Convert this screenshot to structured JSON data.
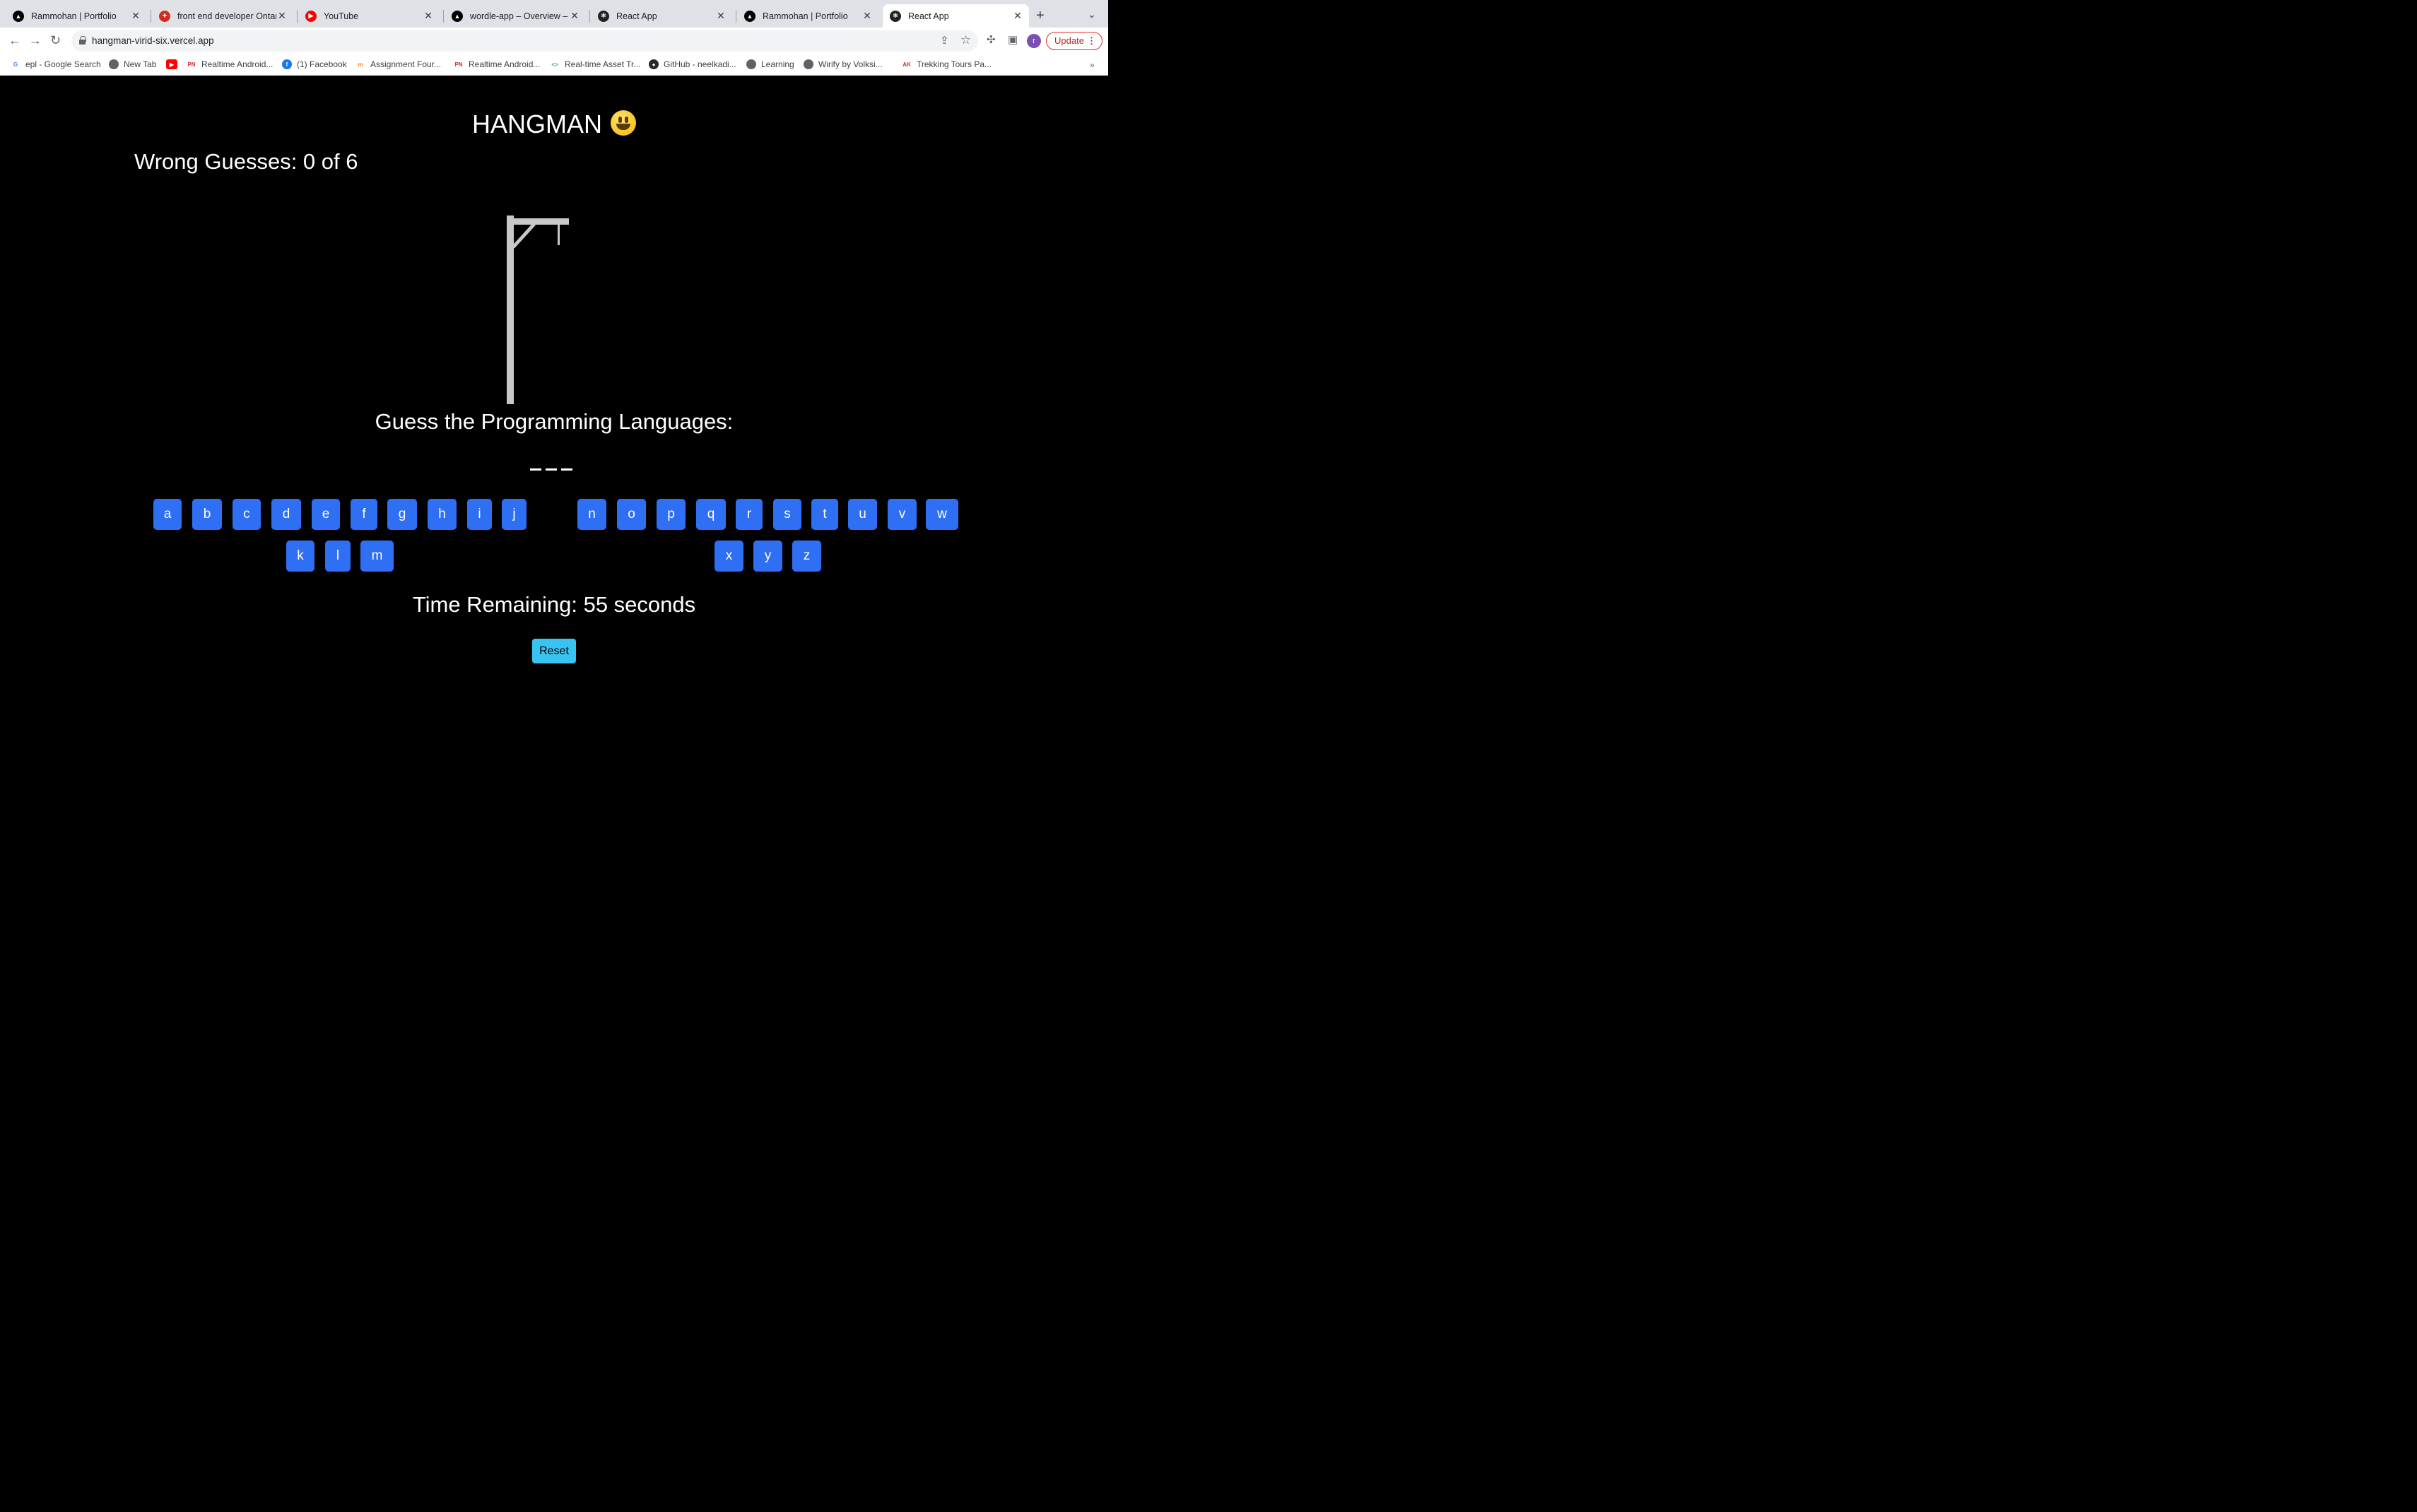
{
  "browser": {
    "tabs": [
      {
        "title": "Rammohan | Portfolio",
        "favicon": "vercel-icon",
        "color": "#000000"
      },
      {
        "title": "front end developer Ontario",
        "favicon": "maple-leaf-icon",
        "color": "#d52b1e"
      },
      {
        "title": "YouTube",
        "favicon": "youtube-icon",
        "color": "#ff0000"
      },
      {
        "title": "wordle-app – Overview – Vercel",
        "favicon": "vercel-icon",
        "color": "#000000"
      },
      {
        "title": "React App",
        "favicon": "react-icon",
        "color": "#222222"
      },
      {
        "title": "Rammohan | Portfolio",
        "favicon": "vercel-icon",
        "color": "#000000"
      },
      {
        "title": "React App",
        "favicon": "react-icon",
        "color": "#222222",
        "active": true
      }
    ],
    "url": "hangman-virid-six.vercel.app",
    "update_label": "Update",
    "profile_initial": "r",
    "bookmarks": [
      {
        "label": "epl - Google Search",
        "icon": "google-icon"
      },
      {
        "label": "New Tab",
        "icon": "globe-icon"
      },
      {
        "label": "",
        "icon": "youtube-icon"
      },
      {
        "label": "Realtime Android...",
        "icon": "pn-icon"
      },
      {
        "label": "(1) Facebook",
        "icon": "facebook-icon"
      },
      {
        "label": "Assignment Four...",
        "icon": "moodle-icon"
      },
      {
        "label": "Realtime Android...",
        "icon": "pn-icon"
      },
      {
        "label": "Real-time Asset Tr...",
        "icon": "code-icon"
      },
      {
        "label": "GitHub - neelkadi...",
        "icon": "github-icon"
      },
      {
        "label": "Learning",
        "icon": "globe-icon"
      },
      {
        "label": "Wirify by Volksi...",
        "icon": "globe-icon"
      },
      {
        "label": "Trekking Tours Pa...",
        "icon": "ak-icon"
      }
    ],
    "bookmarks_more": "»"
  },
  "game": {
    "title": "HANGMAN",
    "emoji": "grinning-face",
    "wrong_guesses": "Wrong Guesses: 0 of 6",
    "prompt": "Guess the Programming Languages:",
    "blank_count": 3,
    "keys_row1_left": [
      "a",
      "b",
      "c",
      "d",
      "e",
      "f",
      "g",
      "h",
      "i",
      "j"
    ],
    "keys_row2_left": [
      "k",
      "l",
      "m"
    ],
    "keys_row1_right": [
      "n",
      "o",
      "p",
      "q",
      "r",
      "s",
      "t",
      "u",
      "v",
      "w"
    ],
    "keys_row2_right": [
      "x",
      "y",
      "z"
    ],
    "timer": "Time Remaining: 55 seconds",
    "reset_label": "Reset",
    "colors": {
      "key": "#2f6ff3",
      "reset": "#38c4f2",
      "gallows": "#c8c8c8",
      "background": "#000000"
    }
  }
}
